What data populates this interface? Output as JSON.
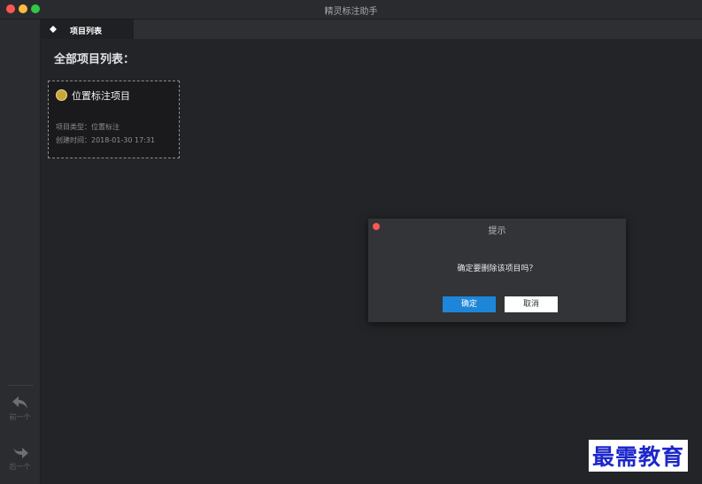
{
  "app": {
    "title": "精灵标注助手"
  },
  "tabs": [
    {
      "label": "项目列表"
    }
  ],
  "main": {
    "section_title": "全部项目列表："
  },
  "project_card": {
    "title": "位置标注项目",
    "type_line": "项目类型：位置标注",
    "created_line": "创建时间：2018-01-30 17:31"
  },
  "sidebar": {
    "prev_label": "前一个",
    "next_label": "后一个"
  },
  "dialog": {
    "title": "提示",
    "message": "确定要删除该项目吗？",
    "ok_label": "确定",
    "cancel_label": "取消"
  },
  "watermark": {
    "text": "最需教育"
  },
  "colors": {
    "accent": "#1e86d8",
    "background": "#232427",
    "close": "#fc5753"
  }
}
